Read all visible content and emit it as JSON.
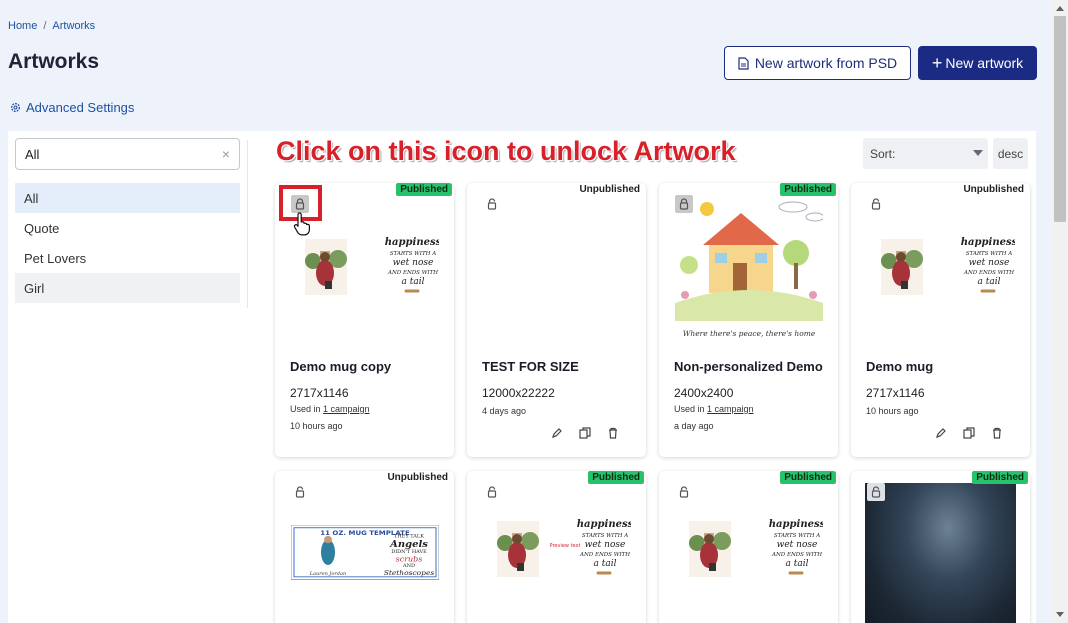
{
  "breadcrumb": {
    "home": "Home",
    "separator": "/",
    "current": "Artworks"
  },
  "page": {
    "title": "Artworks"
  },
  "buttons": {
    "from_psd": "New artwork from PSD",
    "new_artwork": "New artwork",
    "new_plus": "+"
  },
  "advanced_settings": "Advanced Settings",
  "filter": {
    "value": "All",
    "clear": "×"
  },
  "categories": [
    "All",
    "Quote",
    "Pet Lovers",
    "Girl"
  ],
  "annotation": "Click on this icon to unlock Artwork",
  "sort": {
    "label": "Sort:",
    "direction": "desc"
  },
  "thumb_texts": {
    "happiness": [
      "happiness",
      "STARTS WITH A",
      "wet nose",
      "AND ENDS WITH",
      "a tail"
    ],
    "house_caption": "Where there's peace, there's home",
    "preview": "Preview text",
    "mug_template": "11 OZ. MUG TEMPLATE",
    "angels": [
      "THEY TALK",
      "Angels",
      "DIDN'T HAVE",
      "scrubs",
      "AND",
      "Stethoscopes"
    ],
    "nurse_caption": "Lauren Jordan"
  },
  "cards": [
    {
      "title": "Demo mug copy",
      "size": "2717x1146",
      "used_prefix": "Used in",
      "used_link": "1 campaign",
      "time": "10 hours ago",
      "status": "Published"
    },
    {
      "title": "TEST FOR SIZE",
      "size": "12000x22222",
      "time": "4 days ago",
      "status": "Unpublished"
    },
    {
      "title": "Non-personalized Demo",
      "size": "2400x2400",
      "used_prefix": "Used in",
      "used_link": "1 campaign",
      "time": "a day ago",
      "status": "Published"
    },
    {
      "title": "Demo mug",
      "size": "2717x1146",
      "time": "10 hours ago",
      "status": "Unpublished"
    },
    {
      "status": "Unpublished"
    },
    {
      "status": "Published"
    },
    {
      "status": "Published"
    },
    {
      "status": "Published"
    }
  ],
  "colors": {
    "primary": "#1b2a82",
    "published": "#27c26c",
    "annotation": "#d8202a",
    "link": "#1e50a2"
  }
}
